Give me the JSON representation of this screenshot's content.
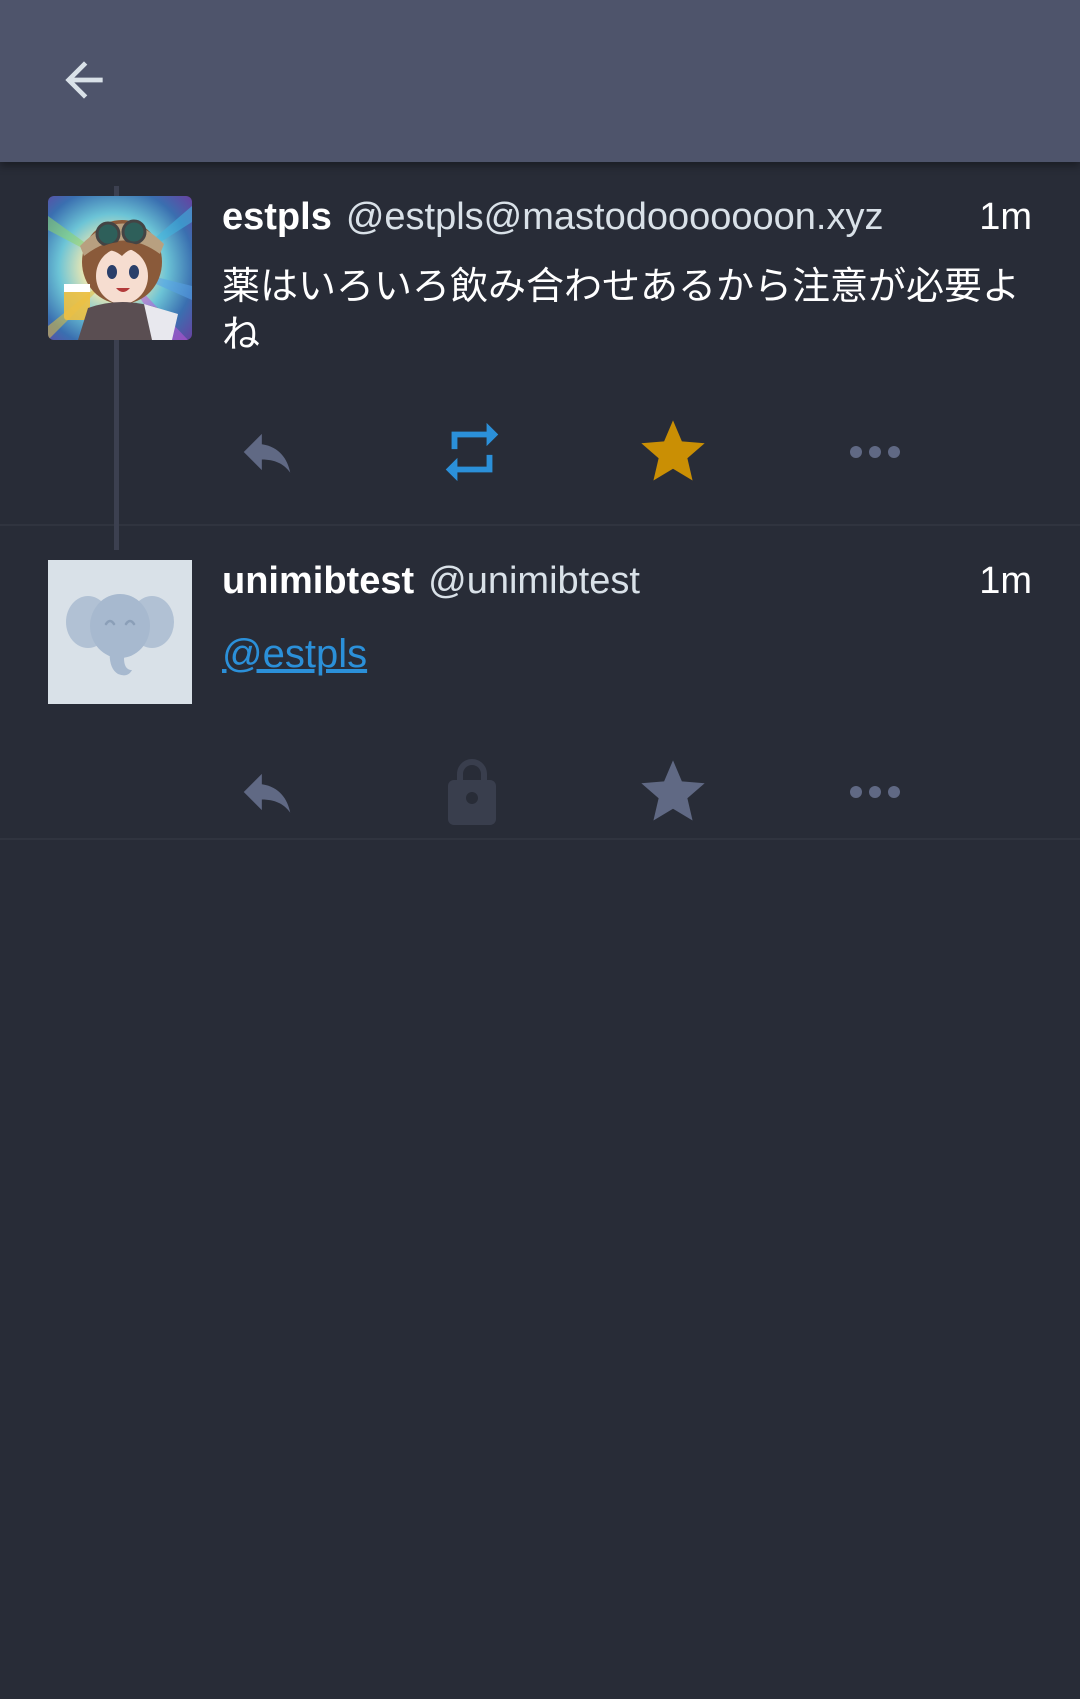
{
  "toolbar": {
    "back_icon": "arrow-left-icon"
  },
  "statuses": [
    {
      "display_name": "estpls",
      "acct": "@estpls@mastodooooooon.xyz",
      "time": "1m",
      "content": "薬はいろいろ飲み合わせあるから注意が必要よね",
      "avatar": "anime-character-avatar",
      "actions": {
        "reply_icon": "reply-icon",
        "boost_icon": "boost-icon",
        "boost_state": "active",
        "favourite_icon": "star-icon",
        "favourite_state": "active",
        "more_icon": "more-icon"
      }
    },
    {
      "display_name": "unimibtest",
      "acct": "@unimibtest",
      "time": "1m",
      "mention": "@estpls",
      "avatar": "default-elephant-avatar",
      "actions": {
        "reply_icon": "reply-icon",
        "boost_icon": "lock-icon",
        "boost_state": "disabled",
        "favourite_icon": "star-icon",
        "favourite_state": "inactive",
        "more_icon": "more-icon"
      }
    }
  ],
  "colors": {
    "toolbar_bg": "#4e546b",
    "background": "#282c37",
    "action_icon": "#606984",
    "boost_active": "#2b90d9",
    "favourite_active": "#ca8f04",
    "lock_icon": "#393e4d",
    "mention_link": "#2b90d9"
  }
}
